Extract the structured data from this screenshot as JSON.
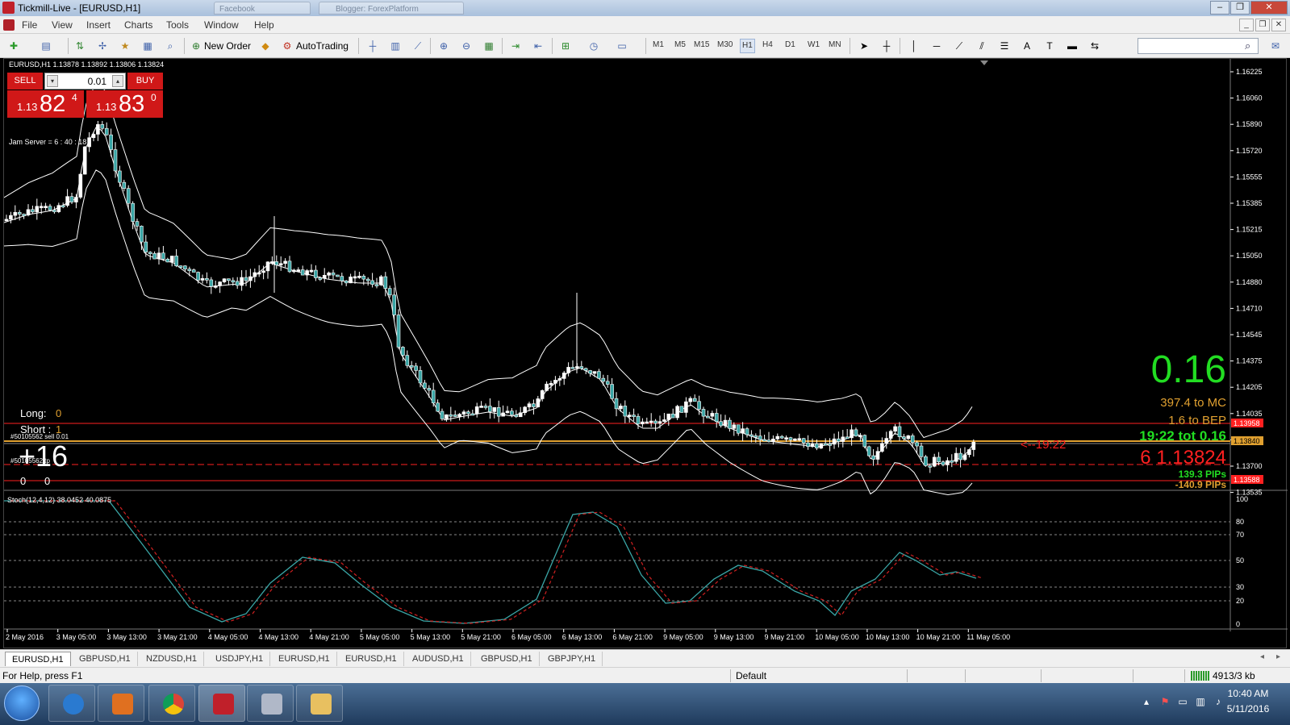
{
  "window": {
    "title": "Tickmill-Live - [EURUSD,H1]",
    "ghost_tab_1": "Facebook",
    "ghost_tab_2": "Blogger: ForexPlatform",
    "minimize": "‒",
    "restore": "❐",
    "close": "✕"
  },
  "menu": {
    "items": [
      "File",
      "View",
      "Insert",
      "Charts",
      "Tools",
      "Window",
      "Help"
    ]
  },
  "toolbar": {
    "new_order": "New Order",
    "autotrading": "AutoTrading",
    "timeframes": [
      "M1",
      "M5",
      "M15",
      "M30",
      "H1",
      "H4",
      "D1",
      "W1",
      "MN"
    ],
    "active_timeframe": "H1"
  },
  "chart": {
    "symbol_info": "EURUSD,H1  1.13878 1.13892 1.13806 1.13824",
    "server_time": "Jam Server = 6 : 40 : 18",
    "long_label": "Long:",
    "long_value": "0",
    "short_label": "Short :",
    "short_value": "1",
    "order_label_1": "#50105562 sell 0.01",
    "order_label_2": "#50105562 tp",
    "pnl_big": "+16",
    "zero_left": "0",
    "zero_right": "0",
    "profit_big": "0.16",
    "to_mc": "397.4  to MC",
    "to_bep": "1.6  to BEP",
    "timer_tot": "19:22   tot  0.16",
    "countdown_arrow": "<--19:22",
    "current_price_row": "6   1.13824",
    "pips_up": "139.3 PIPs",
    "pips_down": "-140.9 PIPs",
    "price_axis": [
      "1.16225",
      "1.16060",
      "1.15890",
      "1.15720",
      "1.15555",
      "1.15385",
      "1.15215",
      "1.15050",
      "1.14880",
      "1.14710",
      "1.14545",
      "1.14375",
      "1.14205",
      "1.14035",
      "1.13865",
      "1.13700",
      "1.13535"
    ],
    "price_tags": {
      "upper_red": "1.13958",
      "gold": "1.13840",
      "lower_red": "1.13588"
    },
    "time_axis": [
      "2 May 2016",
      "3 May 05:00",
      "3 May 13:00",
      "3 May 21:00",
      "4 May 05:00",
      "4 May 13:00",
      "4 May 21:00",
      "5 May 05:00",
      "5 May 13:00",
      "5 May 21:00",
      "6 May 05:00",
      "6 May 13:00",
      "6 May 21:00",
      "9 May 05:00",
      "9 May 13:00",
      "9 May 21:00",
      "10 May 05:00",
      "10 May 13:00",
      "10 May 21:00",
      "11 May 05:00"
    ],
    "stoch_label": "Stoch(12,4,12) 38.0452 40.0875",
    "stoch_axis": [
      "100",
      "80",
      "70",
      "50",
      "30",
      "20",
      "0"
    ]
  },
  "trade_panel": {
    "sell": "SELL",
    "buy": "BUY",
    "lot": "0.01",
    "sell_prefix": "1.13",
    "sell_big": "82",
    "sell_sup": "4",
    "buy_prefix": "1.13",
    "buy_big": "83",
    "buy_sup": "0"
  },
  "tabs": [
    "EURUSD,H1",
    "GBPUSD,H1",
    "NZDUSD,H1",
    "USDJPY,H1",
    "EURUSD,H1",
    "EURUSD,H1",
    "AUDUSD,H1",
    "GBPUSD,H1",
    "GBPJPY,H1"
  ],
  "status": {
    "help": "For Help, press F1",
    "profile": "Default",
    "traffic": "4913/3 kb"
  },
  "taskbar": {
    "time": "10:40 AM",
    "date": "5/11/2016"
  },
  "colors": {
    "profit_green": "#22dd22",
    "gold": "#e0a030",
    "red": "#ff2020",
    "stoch_main": "#3aa6a6",
    "stoch_signal": "#d02020"
  }
}
